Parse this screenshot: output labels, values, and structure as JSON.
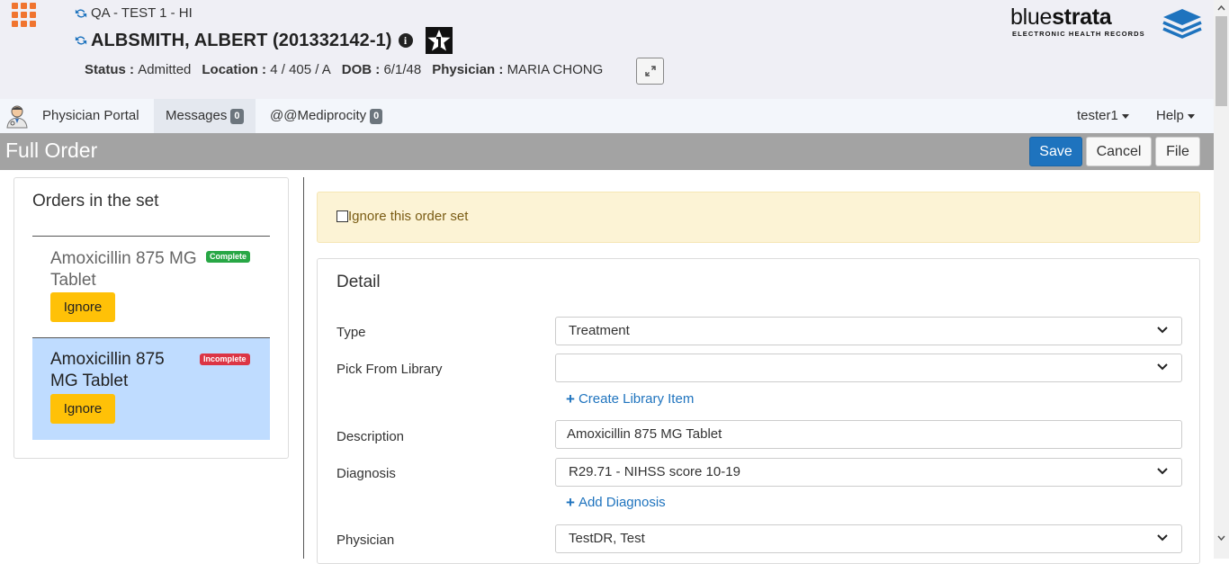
{
  "patient": {
    "ward": "QA - TEST 1 - HI",
    "name": "ALBSMITH, ALBERT (201332142-1)",
    "status_label": "Status :",
    "status": "Admitted",
    "location_label": "Location :",
    "location": "4 / 405 / A",
    "dob_label": "DOB :",
    "dob": "6/1/48",
    "physician_label": "Physician :",
    "physician": "MARIA CHONG"
  },
  "logo": {
    "brand_light": "blue",
    "brand_bold": "strata",
    "tagline": "ELECTRONIC HEALTH RECORDS"
  },
  "nav": {
    "items": [
      {
        "label": "Physician Portal"
      },
      {
        "label": "Messages",
        "count": "0"
      },
      {
        "label": "@@Mediprocity",
        "count": "0"
      }
    ],
    "user": "tester1",
    "help": "Help"
  },
  "titlebar": {
    "title": "Full Order",
    "save": "Save",
    "cancel": "Cancel",
    "file": "File"
  },
  "orders": {
    "heading": "Orders in the set",
    "items": [
      {
        "name": "Amoxicillin 875 MG Tablet",
        "status": "Complete",
        "ignore": "Ignore",
        "selected": false
      },
      {
        "name": "Amoxicillin 875 MG Tablet",
        "status": "Incomplete",
        "ignore": "Ignore",
        "selected": true
      }
    ]
  },
  "ignore_set": {
    "label": "Ignore this order set",
    "checked": false
  },
  "detail": {
    "heading": "Detail",
    "type_label": "Type",
    "type_value": "Treatment",
    "library_label": "Pick From Library",
    "library_value": "",
    "create_library_link": "Create Library Item",
    "description_label": "Description",
    "description_value": "Amoxicillin 875 MG Tablet",
    "diagnosis_label": "Diagnosis",
    "diagnosis_value": "R29.71 - NIHSS score 10-19",
    "add_diagnosis_link": "Add Diagnosis",
    "physician_label": "Physician",
    "physician_value": "TestDR, Test"
  },
  "colors": {
    "primary": "#1e73be",
    "warning": "#ffc107",
    "complete": "#28a745",
    "incomplete": "#dc3545",
    "selected_row": "#bfdcff",
    "titlebar": "#a3a3a3",
    "app_grid": "#f0742f"
  }
}
